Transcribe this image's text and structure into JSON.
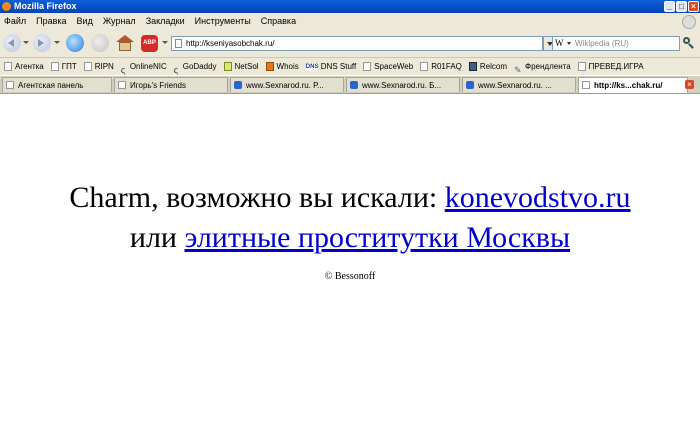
{
  "window": {
    "title": "Mozilla Firefox"
  },
  "menu": [
    "Файл",
    "Правка",
    "Вид",
    "Журнал",
    "Закладки",
    "Инструменты",
    "Справка"
  ],
  "navigation": {
    "url": "http://kseniyasobchak.ru/",
    "search_placeholder": "Wikipedia (RU)",
    "search_engine_icon": "W",
    "adblock_label": "ABP"
  },
  "bookmarks": [
    "Агентка",
    "ГПТ",
    "RIPN",
    "OnlineNIC",
    "GoDaddy",
    "NetSol",
    "Whois",
    "DNS Stuff",
    "SpaceWeb",
    "R01FAQ",
    "Relcom",
    "Френдлента",
    "ПРЕВЕД.ИГРА"
  ],
  "tabs": [
    "Агентская панель",
    "Игорь's Friends",
    "www.Sexnarod.ru. Р...",
    "www.Sexnarod.ru. Б...",
    "www.Sexnarod.ru. ...",
    "http://ks...chak.ru/"
  ],
  "page": {
    "line1_prefix": "Charm, возможно вы искали: ",
    "line1_link": "konevodstvo.ru",
    "line2_prefix": "или ",
    "line2_link": "элитные проститутки Москвы",
    "copyright": "© Bessonoff"
  }
}
